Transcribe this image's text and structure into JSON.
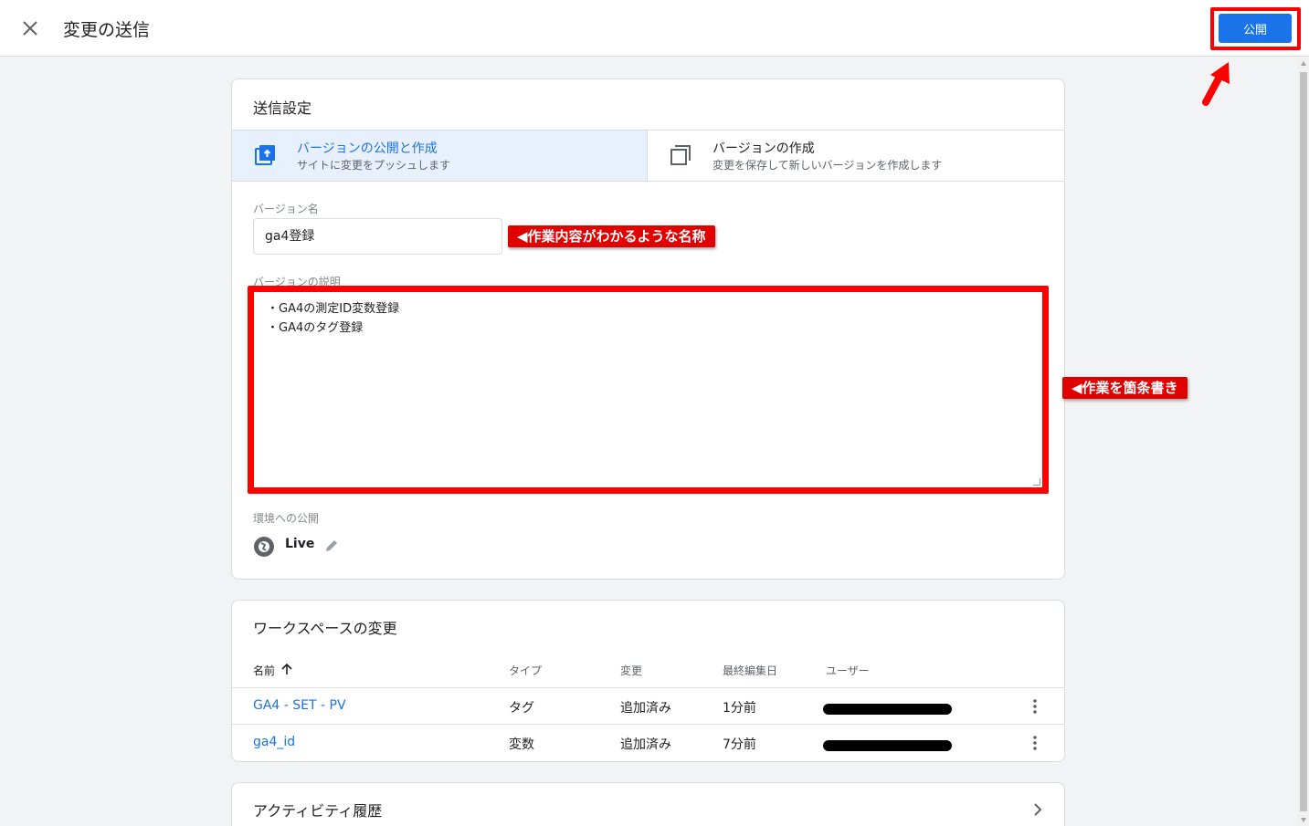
{
  "header": {
    "title": "変更の送信",
    "publish_label": "公開"
  },
  "settings": {
    "title": "送信設定",
    "options": [
      {
        "title": "バージョンの公開と作成",
        "subtitle": "サイトに変更をプッシュします",
        "selected": true,
        "icon": "publish-icon"
      },
      {
        "title": "バージョンの作成",
        "subtitle": "変更を保存して新しいバージョンを作成します",
        "selected": false,
        "icon": "copy-icon"
      }
    ],
    "version_name_label": "バージョン名",
    "version_name_value": "ga4登録",
    "description_label": "バージョンの説明",
    "description_value": "・GA4の測定ID変数登録\n・GA4のタグ登録",
    "environment_label": "環境への公開",
    "environment_name": "Live"
  },
  "annotations": {
    "name_callout": "◀作業内容がわかるような名称",
    "desc_callout": "◀作業を箇条書き"
  },
  "workspace": {
    "title": "ワークスペースの変更",
    "columns": {
      "name": "名前",
      "type": "タイプ",
      "change": "変更",
      "edited": "最終編集日",
      "user": "ユーザー"
    },
    "rows": [
      {
        "name": "GA4 - SET - PV",
        "type": "タグ",
        "change": "追加済み",
        "edited": "1分前"
      },
      {
        "name": "ga4_id",
        "type": "変数",
        "change": "追加済み",
        "edited": "7分前"
      }
    ]
  },
  "activity": {
    "title": "アクティビティ履歴"
  },
  "colors": {
    "accent": "#1a73e8",
    "highlight": "#ff0000",
    "callout": "#e00000"
  }
}
